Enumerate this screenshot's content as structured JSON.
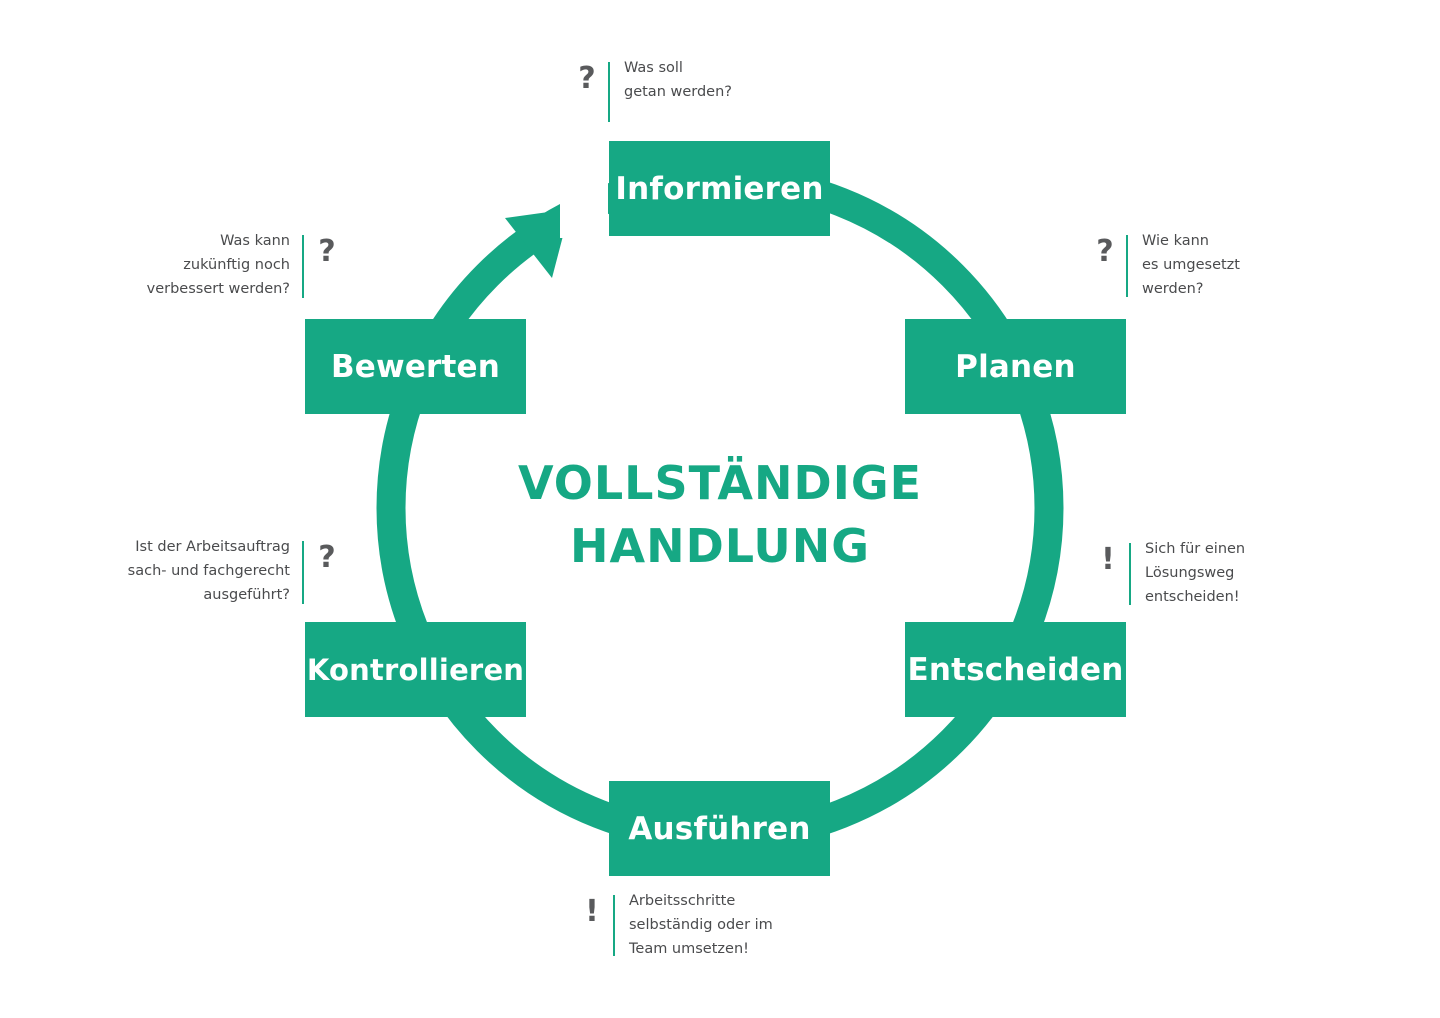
{
  "title": {
    "line1": "VOLLSTÄNDIGE",
    "line2": "HANDLUNG"
  },
  "colors": {
    "accent": "#16a884",
    "mark": "#595a5c",
    "text": "#4a4b4d",
    "background": "#ffffff"
  },
  "stages": {
    "informieren": "Informieren",
    "planen": "Planen",
    "entscheiden": "Entscheiden",
    "ausfuehren": "Ausführen",
    "kontrollieren": "Kontrollieren",
    "bewerten": "Bewerten"
  },
  "notes": {
    "informieren": {
      "mark": "?",
      "lines": [
        "Was soll",
        "getan werden?"
      ]
    },
    "planen": {
      "mark": "?",
      "lines": [
        "Wie kann",
        "es umgesetzt",
        "werden?"
      ]
    },
    "entscheiden": {
      "mark": "!",
      "lines": [
        "Sich für einen",
        "Lösungsweg",
        "entscheiden!"
      ]
    },
    "ausfuehren": {
      "mark": "!",
      "lines": [
        "Arbeitsschritte",
        "selbständig oder im",
        "Team umsetzen!"
      ]
    },
    "kontrollieren": {
      "mark": "?",
      "lines": [
        "Ist der Arbeitsauftrag",
        "sach- und fachgerecht",
        "ausgeführt?"
      ]
    },
    "bewerten": {
      "mark": "?",
      "lines": [
        "Was kann",
        "zukünftig noch",
        "verbessert werden?"
      ]
    }
  },
  "icons": {
    "cycle_arrow": "cycle-arrow-icon"
  }
}
